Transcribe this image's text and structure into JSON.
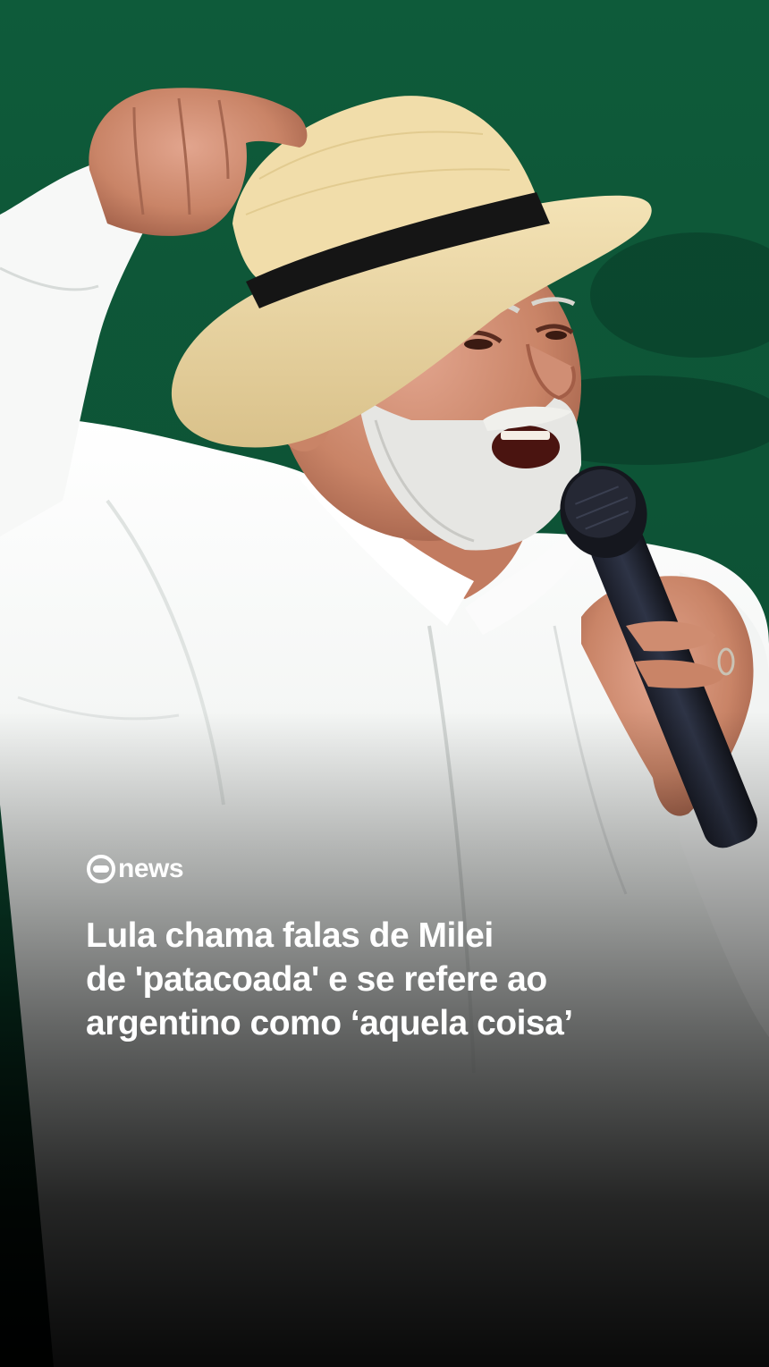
{
  "photo": {
    "subject": "smiling man in straw hat with black band and white shirt speaking into a microphone, fist raised",
    "background_color": "#0f5a3a"
  },
  "brand": {
    "name": "news",
    "icon": "globo-logo-icon"
  },
  "headline": {
    "lines": [
      "Lula chama falas de Milei",
      "de 'patacoada' e se refere ao",
      "argentino como ‘aquela coisa’"
    ]
  },
  "colors": {
    "text": "#ffffff",
    "background_green": "#0f5a3a"
  }
}
